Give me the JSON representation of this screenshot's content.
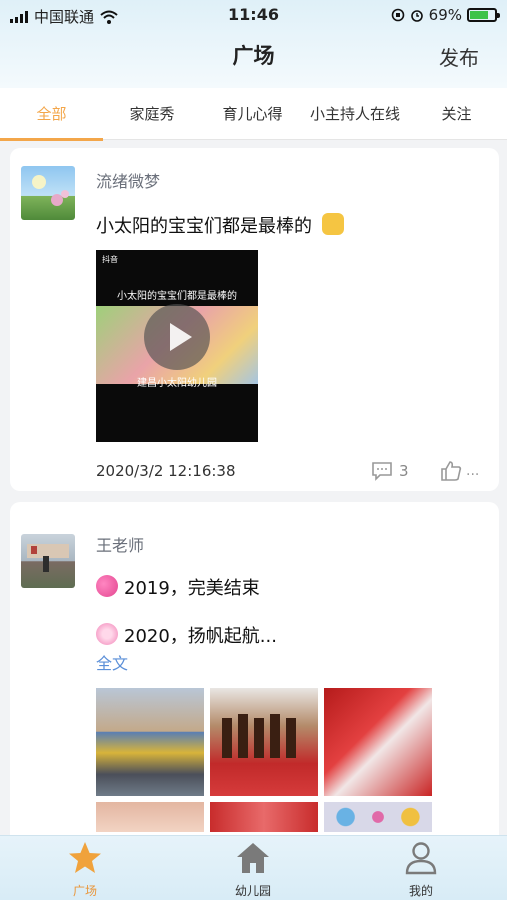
{
  "status_bar": {
    "carrier": "中国联通",
    "time": "11:46",
    "battery": "69%"
  },
  "header": {
    "title": "广场",
    "action": "发布"
  },
  "tabs": [
    {
      "label": "全部",
      "active": true
    },
    {
      "label": "家庭秀"
    },
    {
      "label": "育儿心得"
    },
    {
      "label": "小主持人在线"
    },
    {
      "label": "关注"
    }
  ],
  "posts": [
    {
      "author": "流绪微梦",
      "text": "小太阳的宝宝们都是最棒的",
      "emoji": "fist-icon",
      "video": {
        "brand": "抖音",
        "caption_top": "小太阳的宝宝们都是最棒的",
        "caption_bottom": "建昌小太阳幼儿园"
      },
      "timestamp": "2020/3/2 12:16:38",
      "comment_count": "3",
      "like_more": "..."
    },
    {
      "author": "王老师",
      "line1": "2019，完美结束",
      "line2": "2020，扬帆起航...",
      "full_text_link": "全文"
    }
  ],
  "tabbar": [
    {
      "label": "广场",
      "icon": "star-icon",
      "active": true
    },
    {
      "label": "幼儿园",
      "icon": "house-icon"
    },
    {
      "label": "我的",
      "icon": "person-icon"
    }
  ],
  "colors": {
    "accent": "#f3a64a",
    "link": "#5b8fd8",
    "battery": "#3cc34a"
  }
}
